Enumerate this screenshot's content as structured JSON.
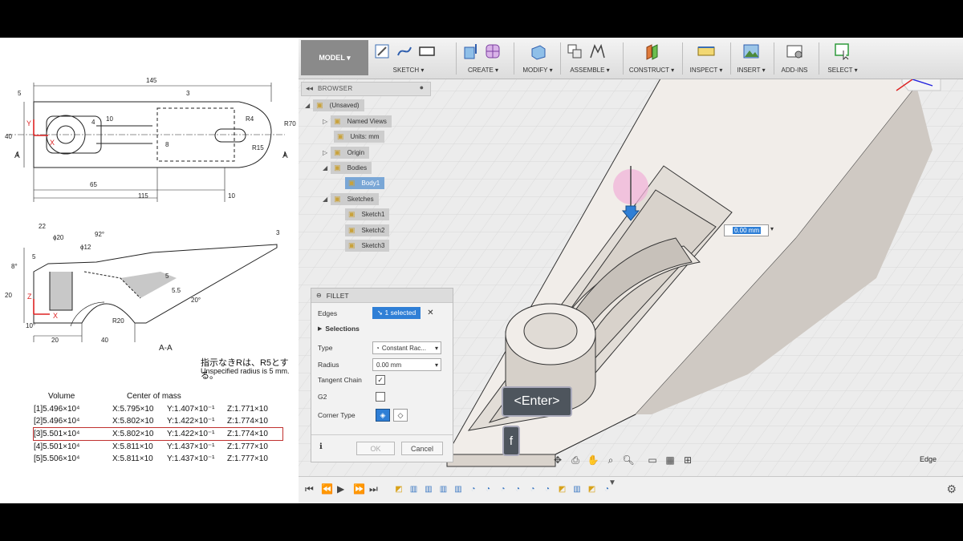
{
  "drawing": {
    "top_dims": [
      "145",
      "5",
      "3",
      "40",
      "4",
      "10",
      "8",
      "R4",
      "R70",
      "R15",
      "65",
      "115",
      "10"
    ],
    "section_label_left": "A",
    "section_label_right": "A",
    "axis_y": "Y",
    "axis_x": "X",
    "axis_z": "Z",
    "side_dims": [
      "22",
      "ϕ20",
      "92°",
      "ϕ12",
      "3",
      "5",
      "8°",
      "20",
      "5",
      "5.5",
      "20°",
      "R20",
      "10°",
      "20",
      "40"
    ],
    "section_caption": "A-A",
    "note_jp": "指示なきRは、R5とする。",
    "note_en": "Unspecified radius is 5 mm.",
    "mass_table": {
      "headers": [
        "Volume",
        "Center of mass"
      ],
      "rows": [
        {
          "vol": "[1]5.496×10⁴",
          "x": "X:5.795×10",
          "y": "Y:1.407×10⁻¹",
          "z": "Z:1.771×10",
          "selected": false
        },
        {
          "vol": "[2]5.496×10⁴",
          "x": "X:5.802×10",
          "y": "Y:1.422×10⁻¹",
          "z": "Z:1.774×10",
          "selected": false
        },
        {
          "vol": "[3]5.501×10⁴",
          "x": "X:5.802×10",
          "y": "Y:1.422×10⁻¹",
          "z": "Z:1.774×10",
          "selected": true
        },
        {
          "vol": "[4]5.501×10⁴",
          "x": "X:5.811×10",
          "y": "Y:1.437×10⁻¹",
          "z": "Z:1.777×10",
          "selected": false
        },
        {
          "vol": "[5]5.506×10⁴",
          "x": "X:5.811×10",
          "y": "Y:1.437×10⁻¹",
          "z": "Z:1.777×10",
          "selected": false
        }
      ]
    }
  },
  "toolbar": {
    "workspace": "MODEL ▾",
    "groups": [
      {
        "label": "SKETCH ▾",
        "icons": [
          "create-sketch-icon",
          "spline-icon",
          "rectangle-icon"
        ]
      },
      {
        "label": "CREATE ▾",
        "icons": [
          "extrude-icon",
          "form-icon"
        ]
      },
      {
        "label": "MODIFY ▾",
        "icons": [
          "press-pull-icon"
        ]
      },
      {
        "label": "ASSEMBLE ▾",
        "icons": [
          "new-component-icon",
          "joint-icon"
        ]
      },
      {
        "label": "CONSTRUCT ▾",
        "icons": [
          "offset-plane-icon"
        ]
      },
      {
        "label": "INSPECT ▾",
        "icons": [
          "measure-icon"
        ]
      },
      {
        "label": "INSERT ▾",
        "icons": [
          "insert-image-icon"
        ]
      },
      {
        "label": "ADD-INS",
        "icons": [
          "scripts-icon"
        ]
      },
      {
        "label": "SELECT ▾",
        "icons": [
          "select-icon"
        ]
      }
    ]
  },
  "browser": {
    "title": "BROWSER",
    "items": [
      {
        "label": "(Unsaved)",
        "selected": false
      },
      {
        "label": "Named Views",
        "selected": false
      },
      {
        "label": "Units: mm",
        "selected": false
      },
      {
        "label": "Origin",
        "selected": false
      },
      {
        "label": "Bodies",
        "selected": false
      },
      {
        "label": "Body1",
        "selected": true
      },
      {
        "label": "Sketches",
        "selected": false
      },
      {
        "label": "Sketch1",
        "selected": false
      },
      {
        "label": "Sketch2",
        "selected": false
      },
      {
        "label": "Sketch3",
        "selected": false
      }
    ]
  },
  "viewport": {
    "dimension_value": "0.00 mm",
    "enter_key": "<Enter>",
    "f_key": "f",
    "selection_filter": "Edge"
  },
  "fillet": {
    "title": "FILLET",
    "edges_label": "Edges",
    "edges_value": "1 selected",
    "selections_label": "Selections",
    "type_label": "Type",
    "type_value": "Constant Rac...",
    "radius_label": "Radius",
    "radius_value": "0.00 mm",
    "tangent_label": "Tangent Chain",
    "tangent_checked": true,
    "g2_label": "G2",
    "g2_checked": false,
    "corner_label": "Corner Type",
    "ok": "OK",
    "cancel": "Cancel"
  },
  "timeline": {
    "controls": [
      "skip-start-icon",
      "step-back-icon",
      "play-icon",
      "step-forward-icon",
      "skip-end-icon"
    ],
    "features": [
      "sketch",
      "extrude",
      "extrude",
      "extrude",
      "extrude",
      "fillet",
      "fillet",
      "fillet",
      "fillet",
      "fillet",
      "fillet",
      "sketch",
      "extrude",
      "sketch",
      "fillet"
    ]
  },
  "colors": {
    "toolbar_bg": "#e4e4e4",
    "model_btn": "#8a8a8a",
    "selection_blue": "#2f7fd6",
    "highlight_red": "#c0312f",
    "body_fill": "#efebe6"
  }
}
